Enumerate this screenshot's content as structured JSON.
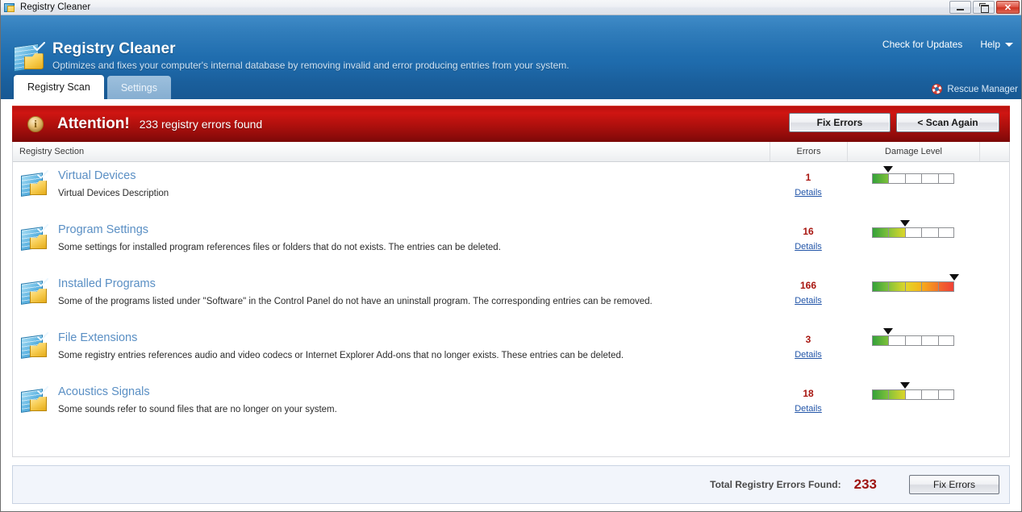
{
  "window": {
    "title": "Registry Cleaner",
    "icon": "registry-cleaner-icon",
    "minimize_label": "",
    "restore_label": "",
    "close_label": "✕"
  },
  "header": {
    "title": "Registry Cleaner",
    "subtitle": "Optimizes and fixes your computer's internal database by removing invalid and error producing entries from your system.",
    "check_updates_label": "Check for Updates",
    "help_label": "Help",
    "rescue_manager_label": "Rescue Manager",
    "tabs": [
      {
        "label": "Registry Scan",
        "active": true
      },
      {
        "label": "Settings",
        "active": false
      }
    ]
  },
  "attention": {
    "icon": "i",
    "title": "Attention!",
    "message": "233 registry errors found",
    "fix_errors_label": "Fix Errors",
    "scan_again_label": "< Scan Again"
  },
  "table": {
    "columns": {
      "section": "Registry Section",
      "errors": "Errors",
      "damage": "Damage Level"
    },
    "details_label": "Details",
    "rows": [
      {
        "title": "Virtual Devices",
        "description": "Virtual Devices Description",
        "errors": "1",
        "details": "Details",
        "damage_filled": 1,
        "damage_total": 5,
        "marker_pct": 20
      },
      {
        "title": "Program Settings",
        "description": "Some settings for installed program references files or folders that do not exists. The entries can be deleted.",
        "errors": "16",
        "details": "Details",
        "damage_filled": 2,
        "damage_total": 5,
        "marker_pct": 40
      },
      {
        "title": "Installed Programs",
        "description": "Some of the programs listed under \"Software\" in the Control Panel do not have an uninstall program. The corresponding entries can be removed.",
        "errors": "166",
        "details": "Details",
        "damage_filled": 5,
        "damage_total": 5,
        "marker_pct": 100
      },
      {
        "title": "File Extensions",
        "description": "Some registry entries references audio and video codecs or Internet Explorer Add-ons that no longer exists. These entries can be deleted.",
        "errors": "3",
        "details": "Details",
        "damage_filled": 1,
        "damage_total": 5,
        "marker_pct": 20
      },
      {
        "title": "Acoustics Signals",
        "description": "Some sounds refer to sound files that are no longer on your system.",
        "errors": "18",
        "details": "Details",
        "damage_filled": 2,
        "damage_total": 5,
        "marker_pct": 40
      }
    ]
  },
  "footer": {
    "total_label": "Total Registry Errors Found:",
    "total_value": "233",
    "fix_errors_label": "Fix Errors"
  },
  "colors": {
    "header_blue": "#1f6cad",
    "alert_red": "#b0100d",
    "link_blue": "#2255a8",
    "section_title": "#5a8fc4",
    "error_count": "#a81610"
  }
}
